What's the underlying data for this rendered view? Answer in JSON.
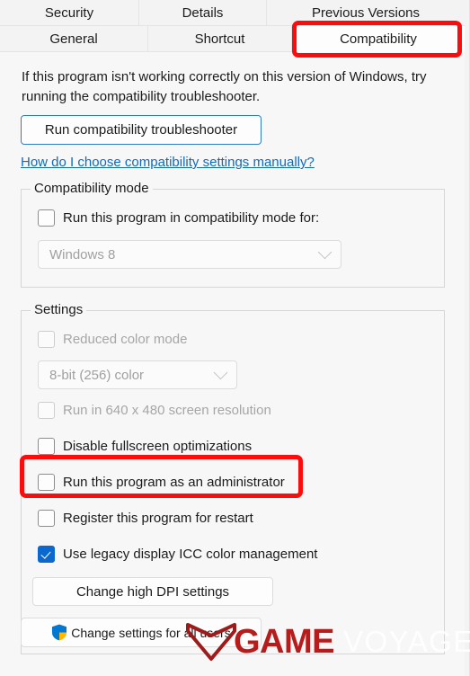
{
  "dialog": {
    "tab_rows": [
      [
        {
          "id": "security",
          "label": "Security",
          "selected": false
        },
        {
          "id": "details",
          "label": "Details",
          "selected": false
        },
        {
          "id": "previous",
          "label": "Previous Versions",
          "selected": false
        }
      ],
      [
        {
          "id": "general",
          "label": "General",
          "selected": false
        },
        {
          "id": "shortcut",
          "label": "Shortcut",
          "selected": false
        },
        {
          "id": "compatibility",
          "label": "Compatibility",
          "selected": true
        }
      ]
    ]
  },
  "main": {
    "intro_text": "If this program isn't working correctly on this version of Windows, try running the compatibility troubleshooter.",
    "troubleshoot_button": "Run compatibility troubleshooter",
    "help_link": "How do I choose compatibility settings manually?"
  },
  "compatibility_mode": {
    "legend": "Compatibility mode",
    "checkbox_label": "Run this program in compatibility mode for:",
    "checkbox_checked": false,
    "checkbox_disabled": false,
    "os_value": "Windows 8",
    "os_disabled": true
  },
  "settings": {
    "legend": "Settings",
    "reduced_color_label": "Reduced color mode",
    "reduced_color_checked": false,
    "reduced_color_disabled": true,
    "color_depth_value": "8-bit (256) color",
    "color_depth_disabled": true,
    "resolution_label": "Run in 640 x 480 screen resolution",
    "resolution_checked": false,
    "resolution_disabled": true,
    "fullscreen_label": "Disable fullscreen optimizations",
    "fullscreen_checked": false,
    "fullscreen_disabled": false,
    "admin_label": "Run this program as an administrator",
    "admin_checked": false,
    "admin_disabled": false,
    "restart_label": "Register this program for restart",
    "restart_checked": false,
    "restart_disabled": false,
    "icc_label": "Use legacy display ICC color management",
    "icc_checked": true,
    "icc_disabled": false,
    "dpi_button": "Change high DPI settings"
  },
  "footer": {
    "all_users_button": "Change settings for all users",
    "shield_icon": "uac-shield-icon"
  },
  "annotations": {
    "highlight_color": "#fc0d0d",
    "boxes": [
      {
        "target": "compatibility-tab"
      },
      {
        "target": "run-as-administrator-checkbox"
      }
    ]
  },
  "watermark": {
    "word_primary": "GAME",
    "word_secondary": "VOYAGERS",
    "primary_color": "#b71c1c",
    "logo_icon": "chevron-v-logo-icon"
  }
}
